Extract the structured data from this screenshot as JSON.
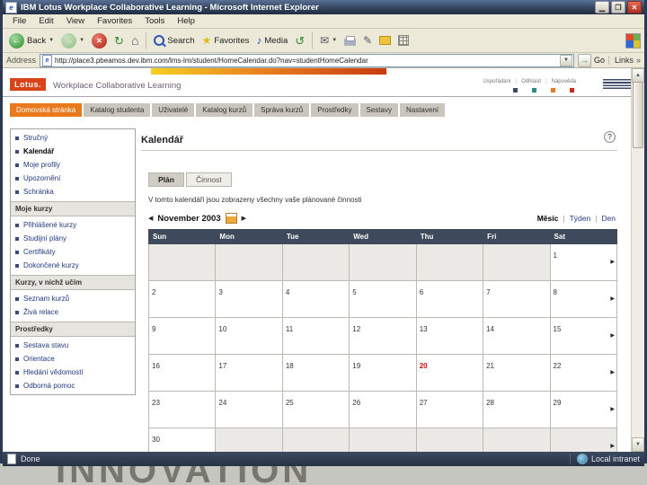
{
  "window": {
    "title": "IBM Lotus Workplace Collaborative Learning - Microsoft Internet Explorer",
    "menu": [
      "File",
      "Edit",
      "View",
      "Favorites",
      "Tools",
      "Help"
    ],
    "toolbar": {
      "back_label": "Back",
      "search_label": "Search",
      "favorites_label": "Favorites",
      "media_label": "Media"
    },
    "address": {
      "label": "Address",
      "url": "http://place3.pbeamos.dev.ibm.com/lms-lm/student/HomeCalendar.do?nav=studentHomeCalendar",
      "go_label": "Go",
      "links_label": "Links"
    },
    "status": {
      "left": "Done",
      "zone": "Local intranet"
    }
  },
  "branding": {
    "logo_text": "Lotus.",
    "logo_bg": "#d84418",
    "product_name": "Workplace Collaborative Learning",
    "utility_links": [
      "Uspořádání",
      "Odhlásit",
      "Nápověda"
    ],
    "accent_colors": [
      "#3e4a6a",
      "#2d8a86",
      "#e87b1e",
      "#c82a1e"
    ],
    "banner_colors": [
      "#f5d020",
      "#e87b1e",
      "#c83a10"
    ]
  },
  "nav_tabs": [
    {
      "label": "Domovská stránka",
      "active": true
    },
    {
      "label": "Katalog studenta",
      "active": false
    },
    {
      "label": "Uživatelé",
      "active": false
    },
    {
      "label": "Katalog kurzů",
      "active": false
    },
    {
      "label": "Správa kurzů",
      "active": false
    },
    {
      "label": "Prostředky",
      "active": false
    },
    {
      "label": "Sestavy",
      "active": false
    },
    {
      "label": "Nastavení",
      "active": false
    }
  ],
  "sidebar": {
    "sections": [
      {
        "header": "",
        "items": [
          {
            "label": "Stručný",
            "active": false
          },
          {
            "label": "Kalendář",
            "active": true
          },
          {
            "label": "Moje profily",
            "active": false
          },
          {
            "label": "Upozornění",
            "active": false
          },
          {
            "label": "Schránka",
            "active": false
          }
        ]
      },
      {
        "header": "Moje kurzy",
        "items": [
          {
            "label": "Přihlášené kurzy",
            "active": false
          },
          {
            "label": "Studijní plány",
            "active": false
          },
          {
            "label": "Certifikáty",
            "active": false
          },
          {
            "label": "Dokončené kurzy",
            "active": false
          }
        ]
      },
      {
        "header": "Kurzy, v nichž učím",
        "items": [
          {
            "label": "Seznam kurzů",
            "active": false
          },
          {
            "label": "Živá relace",
            "active": false
          }
        ]
      },
      {
        "header": "Prostředky",
        "items": [
          {
            "label": "Sestava stavu",
            "active": false
          },
          {
            "label": "Orientace",
            "active": false
          },
          {
            "label": "Hledání vědomostí",
            "active": false
          },
          {
            "label": "Odborná pomoc",
            "active": false
          }
        ]
      }
    ]
  },
  "main": {
    "title": "Kalendář",
    "help_label": "?",
    "view_tabs": [
      {
        "label": "Plán",
        "active": true
      },
      {
        "label": "Činnost",
        "active": false
      }
    ],
    "description": "V tomto kalendáři jsou zobrazeny všechny vaše plánované činnosti",
    "month_nav": {
      "prev": "◀",
      "label": "November 2003",
      "next": "▶",
      "views": [
        {
          "label": "Měsíc",
          "active": true
        },
        {
          "label": "Týden",
          "active": false
        },
        {
          "label": "Den",
          "active": false
        }
      ]
    }
  },
  "calendar": {
    "day_headers": [
      "Sun",
      "Mon",
      "Tue",
      "Wed",
      "Thu",
      "Fri",
      "Sat"
    ],
    "today_color": "#cc1111",
    "weeks": [
      [
        {
          "day": "",
          "out": true
        },
        {
          "day": "",
          "out": true
        },
        {
          "day": "",
          "out": true
        },
        {
          "day": "",
          "out": true
        },
        {
          "day": "",
          "out": true
        },
        {
          "day": "",
          "out": true
        },
        {
          "day": "1"
        }
      ],
      [
        {
          "day": "2"
        },
        {
          "day": "3"
        },
        {
          "day": "4"
        },
        {
          "day": "5"
        },
        {
          "day": "6"
        },
        {
          "day": "7"
        },
        {
          "day": "8"
        }
      ],
      [
        {
          "day": "9"
        },
        {
          "day": "10"
        },
        {
          "day": "11"
        },
        {
          "day": "12"
        },
        {
          "day": "13"
        },
        {
          "day": "14"
        },
        {
          "day": "15"
        }
      ],
      [
        {
          "day": "16"
        },
        {
          "day": "17"
        },
        {
          "day": "18"
        },
        {
          "day": "19"
        },
        {
          "day": "20",
          "today": true
        },
        {
          "day": "21"
        },
        {
          "day": "22"
        }
      ],
      [
        {
          "day": "23"
        },
        {
          "day": "24"
        },
        {
          "day": "25"
        },
        {
          "day": "26"
        },
        {
          "day": "27"
        },
        {
          "day": "28"
        },
        {
          "day": "29"
        }
      ],
      [
        {
          "day": "30"
        },
        {
          "day": "",
          "out": true
        },
        {
          "day": "",
          "out": true
        },
        {
          "day": "",
          "out": true
        },
        {
          "day": "",
          "out": true
        },
        {
          "day": "",
          "out": true
        },
        {
          "day": "",
          "out": true
        }
      ]
    ]
  },
  "background": {
    "ghost_text": "INNOVATION"
  },
  "throbber_colors": [
    "#e04a2a",
    "#6ab04c",
    "#2a6ae0",
    "#e0c02a"
  ]
}
